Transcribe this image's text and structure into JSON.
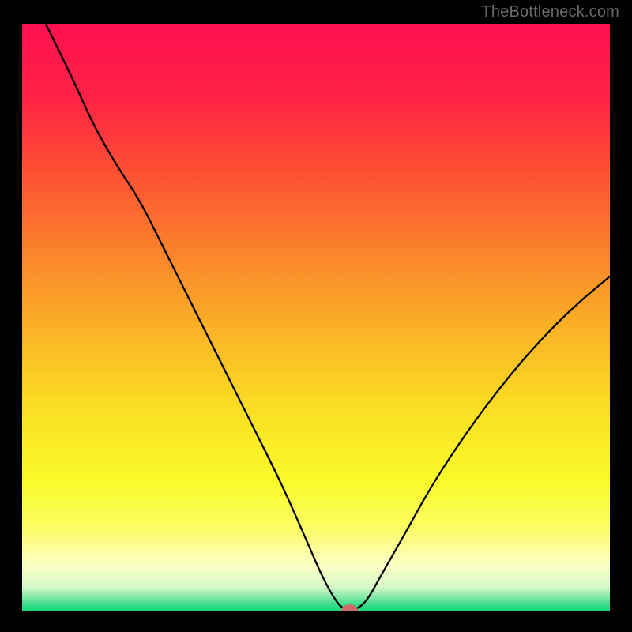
{
  "watermark": "TheBottleneck.com",
  "chart_data": {
    "type": "line",
    "title": "",
    "xlabel": "",
    "ylabel": "",
    "xlim": [
      0,
      100
    ],
    "ylim": [
      0,
      100
    ],
    "grid": false,
    "legend": false,
    "background_gradient_stops": [
      {
        "offset": 0.0,
        "color": "#ff1051"
      },
      {
        "offset": 0.12,
        "color": "#ff2145"
      },
      {
        "offset": 0.25,
        "color": "#fd4f34"
      },
      {
        "offset": 0.38,
        "color": "#fb802c"
      },
      {
        "offset": 0.52,
        "color": "#fab226"
      },
      {
        "offset": 0.65,
        "color": "#fadd23"
      },
      {
        "offset": 0.78,
        "color": "#fafb2a"
      },
      {
        "offset": 0.86,
        "color": "#fbfd66"
      },
      {
        "offset": 0.92,
        "color": "#fdfec4"
      },
      {
        "offset": 0.958,
        "color": "#d7f8c6"
      },
      {
        "offset": 0.975,
        "color": "#87e9a8"
      },
      {
        "offset": 0.99,
        "color": "#30db88"
      },
      {
        "offset": 1.0,
        "color": "#16d781"
      }
    ],
    "series": [
      {
        "name": "bottleneck-curve",
        "color": "#000000",
        "width": 2.3,
        "x": [
          4.0,
          8.0,
          12.0,
          16.0,
          20.0,
          24.0,
          28.0,
          32.0,
          36.0,
          40.0,
          44.0,
          48.0,
          51.0,
          53.5,
          55.0,
          56.5,
          58.5,
          61.0,
          65.0,
          70.0,
          76.0,
          82.0,
          88.0,
          94.0,
          100.0
        ],
        "y": [
          100.0,
          92.0,
          83.0,
          76.0,
          70.0,
          62.0,
          54.0,
          46.0,
          38.0,
          30.0,
          22.0,
          13.0,
          6.0,
          1.5,
          0.2,
          0.2,
          1.5,
          6.0,
          13.0,
          22.0,
          31.0,
          39.0,
          46.0,
          52.0,
          57.0
        ]
      }
    ],
    "marker": {
      "name": "current-point-marker",
      "x": 55.7,
      "y": 0.2,
      "rx": 1.4,
      "ry": 1.0,
      "fill": "#d06a6b"
    }
  }
}
